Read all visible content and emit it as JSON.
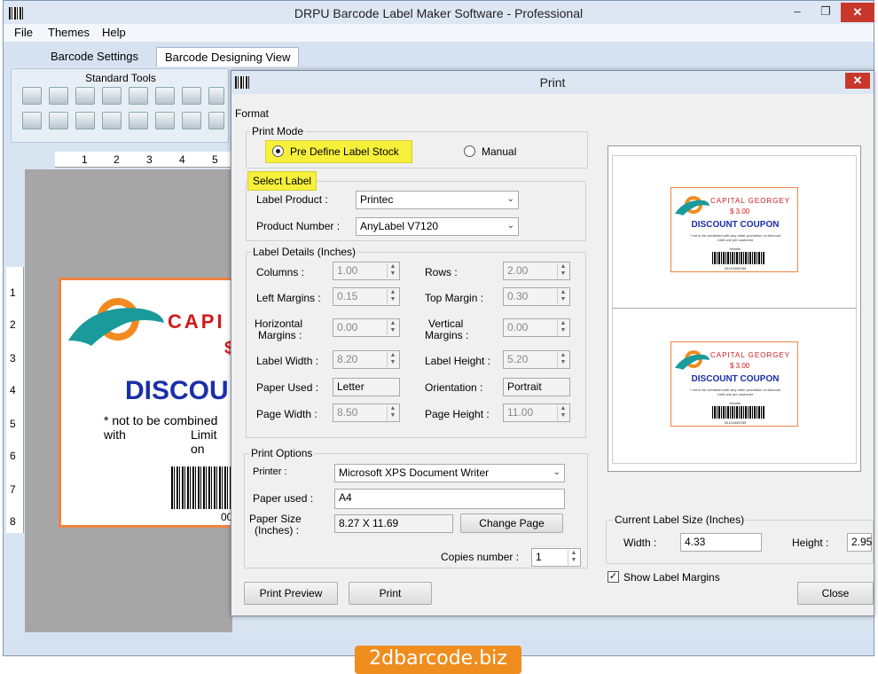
{
  "window": {
    "title": "DRPU Barcode Label Maker Software - Professional"
  },
  "menu": {
    "items": [
      "File",
      "Themes",
      "Help"
    ]
  },
  "tabs": [
    "Barcode Settings",
    "Barcode Designing View"
  ],
  "toolbox": {
    "title": "Standard Tools"
  },
  "ruler": {
    "top_marks": [
      "1",
      "2",
      "3",
      "4",
      "5"
    ],
    "left_marks": [
      "1",
      "2",
      "3",
      "4",
      "5",
      "6",
      "7",
      "8"
    ]
  },
  "canvas_label": {
    "company": "CAPI",
    "price": "$",
    "heading": "DISCOU",
    "line1": "* not to be combined with",
    "line2": "Limit on",
    "barcode_digits": "00"
  },
  "brand": "2dbarcode.biz",
  "dialog": {
    "title": "Print",
    "format_label": "Format",
    "print_mode": {
      "title": "Print Mode",
      "options": [
        "Pre Define Label Stock",
        "Manual"
      ],
      "selected": "Pre Define Label Stock"
    },
    "select_label": {
      "title": "Select Label",
      "product_label": "Label Product :",
      "product_value": "Printec",
      "number_label": "Product Number :",
      "number_value": "AnyLabel V7120"
    },
    "details": {
      "title": "Label Details (Inches)",
      "columns_label": "Columns :",
      "columns": "1.00",
      "rows_label": "Rows :",
      "rows": "2.00",
      "left_label": "Left Margins :",
      "left": "0.15",
      "top_label": "Top Margin :",
      "top": "0.30",
      "hmargin_label1": "Horizontal",
      "hmargin_label2": "Margins :",
      "hmargin": "0.00",
      "vmargin_label1": "Vertical",
      "vmargin_label2": "Margins :",
      "vmargin": "0.00",
      "lwidth_label": "Label Width :",
      "lwidth": "8.20",
      "lheight_label": "Label Height :",
      "lheight": "5.20",
      "paper_label": "Paper Used :",
      "paper": "Letter",
      "orient_label": "Orientation :",
      "orient": "Portrait",
      "pwidth_label": "Page Width :",
      "pwidth": "8.50",
      "pheight_label": "Page Height :",
      "pheight": "11.00"
    },
    "print_options": {
      "title": "Print Options",
      "printer_label": "Printer :",
      "printer": "Microsoft XPS Document Writer",
      "paper_used_label": "Paper used :",
      "paper_used": "A4",
      "paper_size_label1": "Paper Size",
      "paper_size_label2": "(Inches) :",
      "paper_size": "8.27 X 11.69",
      "change_page": "Change Page",
      "copies_label": "Copies number :",
      "copies": "1"
    },
    "preview_label": {
      "company": "CAPITAL GEORGEY",
      "price": "$ 3.00",
      "heading": "DISCOUNT COUPON",
      "fine1": "* not to be combined with any other promotion or discount",
      "fine2": "Limit one per customer",
      "header": "Header",
      "digits": "00123456789"
    },
    "current_size": {
      "title": "Current Label Size (Inches)",
      "width_label": "Width :",
      "width": "4.33",
      "height_label": "Height :",
      "height": "2.95"
    },
    "show_margins": {
      "label": "Show Label Margins",
      "checked": true
    },
    "buttons": {
      "preview": "Print Preview",
      "print": "Print",
      "close": "Close"
    }
  },
  "colors": {
    "accent_orange": "#f08345",
    "coupon_red": "#d01a1a",
    "coupon_blue": "#1b2fa8",
    "highlight": "#f6f03a",
    "close_red": "#c8372c"
  }
}
